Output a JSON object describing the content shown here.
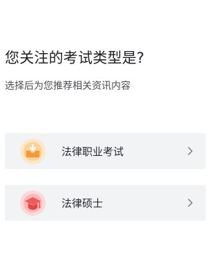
{
  "header": {
    "title": "您关注的考试类型是?",
    "subtitle": "选择后为您推荐相关资讯内容"
  },
  "options": [
    {
      "label": "法律职业考试",
      "icon": "inbox-download-icon",
      "icon_color": "#f29a3a",
      "icon_bg": "#fde7c6"
    },
    {
      "label": "法律硕士",
      "icon": "graduation-cap-icon",
      "icon_color": "#ef5a5a",
      "icon_bg": "#fcd9d9"
    }
  ],
  "colors": {
    "background": "#ffffff",
    "card": "#f2f3f5",
    "text_primary": "#1f2025",
    "text_secondary": "#4a4c52",
    "chevron": "#7a7c82"
  }
}
